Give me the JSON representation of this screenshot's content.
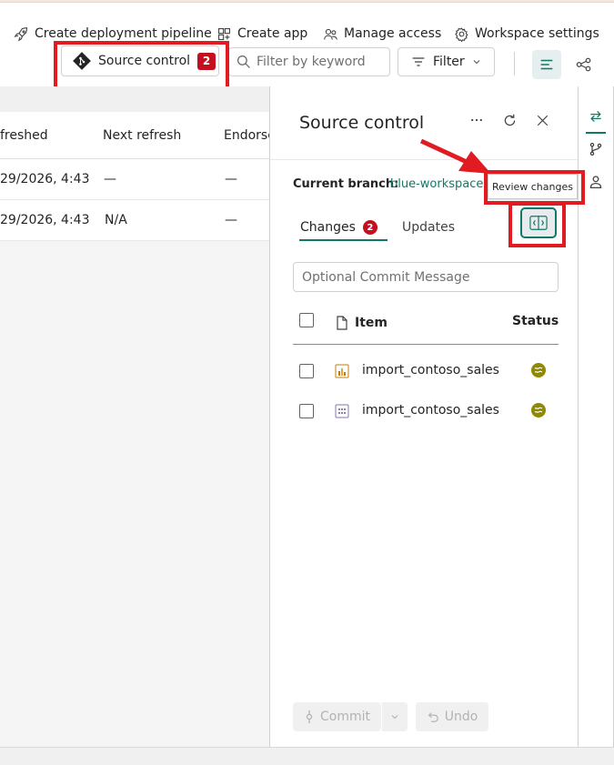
{
  "toolbar": {
    "create_pipeline": "Create deployment pipeline",
    "create_app": "Create app",
    "manage_access": "Manage access",
    "workspace_settings": "Workspace settings",
    "source_control_label": "Source control",
    "source_control_count": "2",
    "filter_placeholder": "Filter by keyword",
    "filter_label": "Filter"
  },
  "table": {
    "columns": [
      "freshed",
      "Next refresh",
      "Endorse"
    ],
    "rows": [
      [
        "29/2026, 4:43:...",
        "—",
        "—"
      ],
      [
        "29/2026, 4:43...",
        "N/A",
        "—"
      ]
    ]
  },
  "panel": {
    "title": "Source control",
    "current_branch_label": "Current branch:",
    "current_branch_value": "blue-workspace-",
    "tooltip": "Review changes",
    "tabs": {
      "changes_label": "Changes",
      "changes_count": "2",
      "updates_label": "Updates"
    },
    "commit_placeholder": "Optional Commit Message",
    "list_header": {
      "item": "Item",
      "status": "Status"
    },
    "items": [
      {
        "name": "import_contoso_sales",
        "icon": "report-icon"
      },
      {
        "name": "import_contoso_sales",
        "icon": "semantic-model-icon"
      }
    ],
    "commit_label": "Commit",
    "undo_label": "Undo"
  },
  "colors": {
    "accent": "#117865",
    "badge": "#c50f1f",
    "annotation": "#e01b22",
    "status": "#8f8a00"
  }
}
